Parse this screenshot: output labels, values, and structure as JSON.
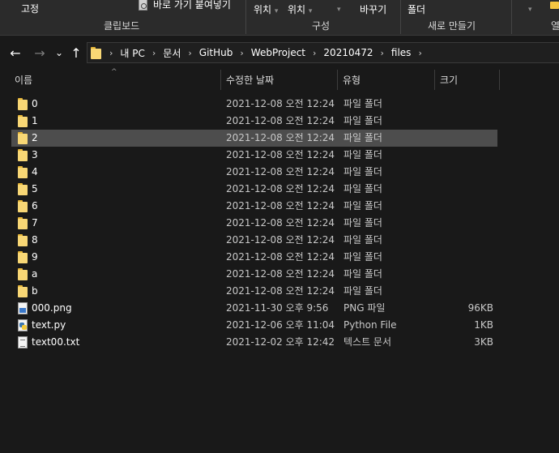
{
  "ribbon": {
    "pin_label": "고정",
    "copy_path_label": "바로 가기 붙여넣기",
    "move_to_label": "위치",
    "copy_to_label": "위치",
    "rename_label": "바꾸기",
    "new_folder_label": "폴더",
    "groups": {
      "clipboard": "클립보드",
      "organize": "구성",
      "new": "새로 만들기",
      "open": "열"
    }
  },
  "nav": {
    "back_icon": "←",
    "forward_icon": "→",
    "recent_icon": "⌄",
    "up_icon": "↑"
  },
  "breadcrumb": [
    "내 PC",
    "문서",
    "GitHub",
    "WebProject",
    "20210472",
    "files"
  ],
  "columns": {
    "name": "이름",
    "date": "수정한 날짜",
    "type": "유형",
    "size": "크기"
  },
  "files": [
    {
      "name": "0",
      "date": "2021-12-08 오전 12:24",
      "type": "파일 폴더",
      "size": "",
      "icon": "folder-icon"
    },
    {
      "name": "1",
      "date": "2021-12-08 오전 12:24",
      "type": "파일 폴더",
      "size": "",
      "icon": "folder-icon"
    },
    {
      "name": "2",
      "date": "2021-12-08 오전 12:24",
      "type": "파일 폴더",
      "size": "",
      "icon": "folder-icon",
      "selected": true
    },
    {
      "name": "3",
      "date": "2021-12-08 오전 12:24",
      "type": "파일 폴더",
      "size": "",
      "icon": "folder-icon"
    },
    {
      "name": "4",
      "date": "2021-12-08 오전 12:24",
      "type": "파일 폴더",
      "size": "",
      "icon": "folder-icon"
    },
    {
      "name": "5",
      "date": "2021-12-08 오전 12:24",
      "type": "파일 폴더",
      "size": "",
      "icon": "folder-icon"
    },
    {
      "name": "6",
      "date": "2021-12-08 오전 12:24",
      "type": "파일 폴더",
      "size": "",
      "icon": "folder-icon"
    },
    {
      "name": "7",
      "date": "2021-12-08 오전 12:24",
      "type": "파일 폴더",
      "size": "",
      "icon": "folder-icon"
    },
    {
      "name": "8",
      "date": "2021-12-08 오전 12:24",
      "type": "파일 폴더",
      "size": "",
      "icon": "folder-icon"
    },
    {
      "name": "9",
      "date": "2021-12-08 오전 12:24",
      "type": "파일 폴더",
      "size": "",
      "icon": "folder-icon"
    },
    {
      "name": "a",
      "date": "2021-12-08 오전 12:24",
      "type": "파일 폴더",
      "size": "",
      "icon": "folder-icon"
    },
    {
      "name": "b",
      "date": "2021-12-08 오전 12:24",
      "type": "파일 폴더",
      "size": "",
      "icon": "folder-icon"
    },
    {
      "name": "000.png",
      "date": "2021-11-30 오후 9:56",
      "type": "PNG 파일",
      "size": "96KB",
      "icon": "png-file-icon"
    },
    {
      "name": "text.py",
      "date": "2021-12-06 오후 11:04",
      "type": "Python File",
      "size": "1KB",
      "icon": "python-file-icon"
    },
    {
      "name": "text00.txt",
      "date": "2021-12-02 오후 12:42",
      "type": "텍스트 문서",
      "size": "3KB",
      "icon": "text-file-icon"
    }
  ],
  "colors": {
    "background": "#191919",
    "ribbon": "#2b2b2b",
    "selection": "#4d4d4d",
    "folder": "#f8d775"
  }
}
